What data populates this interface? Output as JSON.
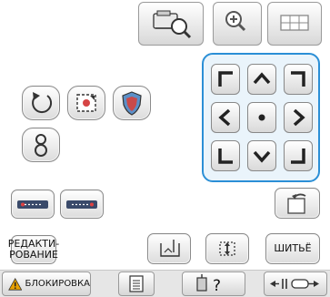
{
  "top_toolbar": {
    "items": [
      {
        "name": "embroidery-preview-button",
        "icon": "machine-magnifier-icon"
      },
      {
        "name": "zoom-button",
        "icon": "magnifier-plus-icon"
      },
      {
        "name": "grid-button",
        "icon": "grid-icon"
      }
    ]
  },
  "edit_buttons": {
    "rotate": {
      "icon": "rotate-icon"
    },
    "frame": {
      "icon": "hoop-frame-icon"
    },
    "shield": {
      "icon": "shield-icon"
    },
    "thread_density": {
      "icon": "figure-eight-icon"
    }
  },
  "move_pad": {
    "accent_color": "#2b8fd6",
    "buttons": [
      {
        "name": "move-up-left",
        "icon": "corner-up-left-icon"
      },
      {
        "name": "move-up",
        "icon": "chevron-up-icon"
      },
      {
        "name": "move-up-right",
        "icon": "corner-up-right-icon"
      },
      {
        "name": "move-left",
        "icon": "chevron-left-icon"
      },
      {
        "name": "move-center",
        "icon": "center-dot-icon"
      },
      {
        "name": "move-right",
        "icon": "chevron-right-icon"
      },
      {
        "name": "move-down-left",
        "icon": "corner-down-left-icon"
      },
      {
        "name": "move-down",
        "icon": "chevron-down-icon"
      },
      {
        "name": "move-down-right",
        "icon": "corner-down-right-icon"
      }
    ]
  },
  "lower_buttons": {
    "edit_label_line1": "РЕДАКТИ-",
    "edit_label_line2": "РОВАНИЕ",
    "sew_label": "ШИТЬЁ"
  },
  "bottom_bar": {
    "lock_label": "БЛОКИРОВКА",
    "lock_icon_color": "#e8a000"
  }
}
